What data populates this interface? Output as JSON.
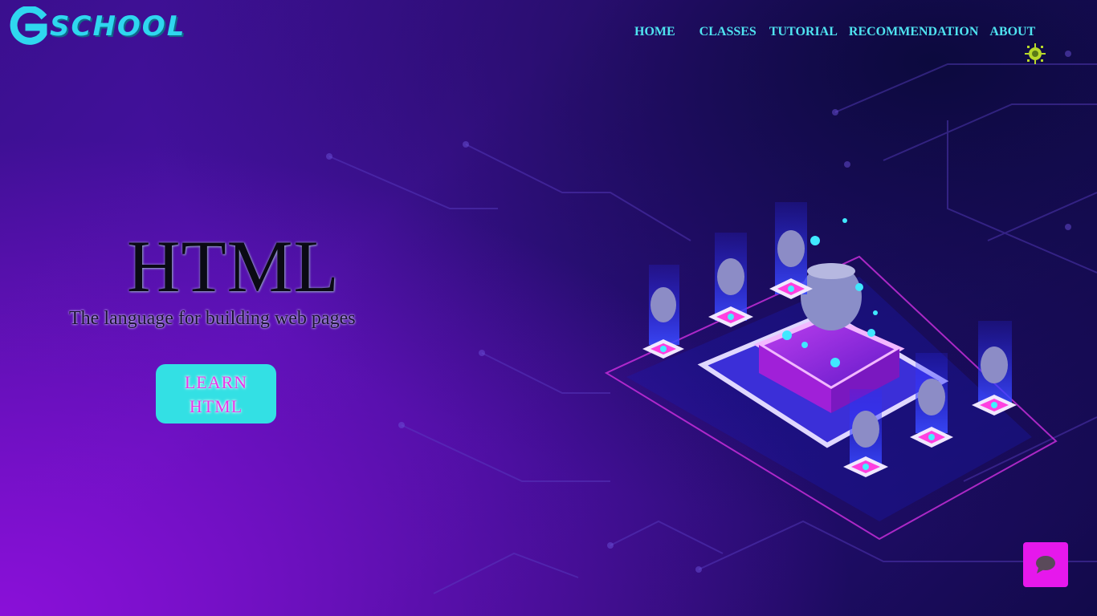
{
  "brand": {
    "logo_letter": "G",
    "name": "SCHOOL"
  },
  "nav": {
    "home": "HOME",
    "classes": "CLASSES",
    "tutorial": "TUTORIAL",
    "recommendation": "RECOMMENDATION",
    "about": "ABOUT"
  },
  "hero": {
    "title": "HTML",
    "subtitle": "The language for building web pages",
    "button_label": "LEARN HTML"
  },
  "icons": {
    "badge": "sun-badge-icon",
    "chat": "chat-bubble-icon",
    "illustration": "isometric-server-illustration"
  },
  "colors": {
    "accent_cyan": "#33e0e4",
    "accent_magenta": "#e618ec",
    "nav_text": "#4fe3f0"
  }
}
